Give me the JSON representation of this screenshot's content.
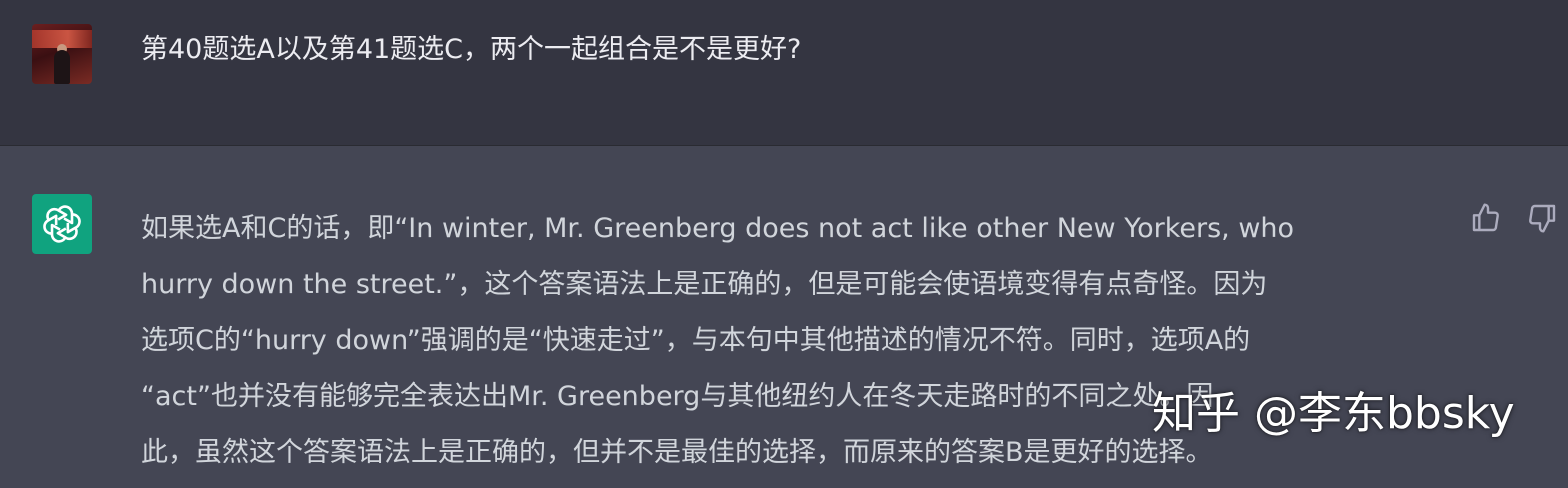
{
  "colors": {
    "user_bg": "#343541",
    "assistant_bg": "#444654",
    "gpt_brand": "#10a37f",
    "text_primary": "#ececf1",
    "text_secondary": "#d1d5db"
  },
  "user_message": {
    "avatar_icon": "user-photo-avatar",
    "text": "第40题选A以及第41题选C，两个一起组合是不是更好?"
  },
  "assistant_message": {
    "avatar_icon": "openai-logo-icon",
    "lines": [
      "如果选A和C的话，即“In winter, Mr. Greenberg does not act like other New Yorkers, who",
      "hurry down the street.”，这个答案语法上是正确的，但是可能会使语境变得有点奇怪。因为",
      "选项C的“hurry down”强调的是“快速走过”，与本句中其他描述的情况不符。同时，选项A的",
      "“act”也并没有能够完全表达出Mr. Greenberg与其他纽约人在冬天走路时的不同之处。因",
      "此，虽然这个答案语法上是正确的，但并不是最佳的选择，而原来的答案B是更好的选择。"
    ],
    "feedback": {
      "thumbs_up_icon": "thumbs-up-icon",
      "thumbs_down_icon": "thumbs-down-icon"
    }
  },
  "watermark": {
    "text": "知乎 @李东bbsky"
  }
}
